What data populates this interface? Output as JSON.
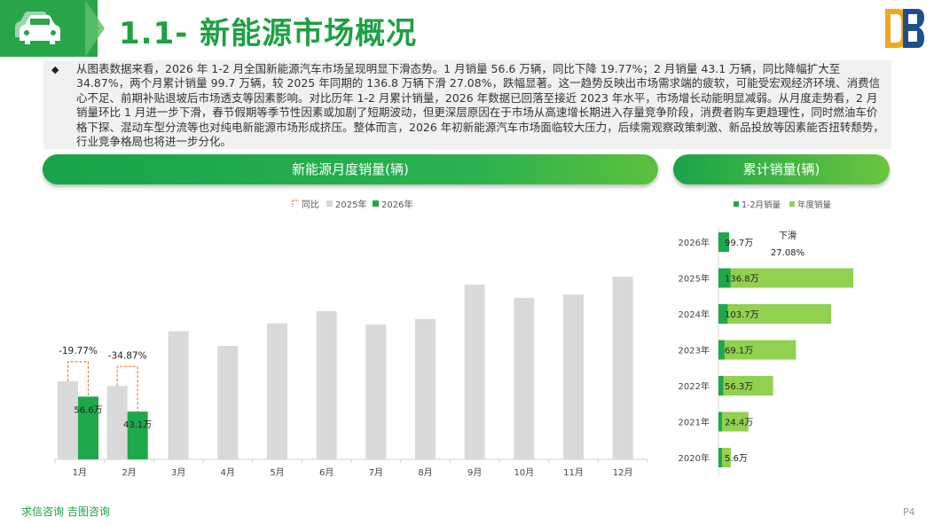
{
  "header": {
    "title": "1.1- 新能源市场概况",
    "car_icon": "car-icon",
    "logo_icon": "brand-logo-icon",
    "colors": {
      "primary": "#27a548",
      "accent": "#1ea043"
    }
  },
  "summary": {
    "bullet": "◆",
    "text": "从图表数据来看，2026 年 1-2 月全国新能源汽车市场呈现明显下滑态势。1 月销量 56.6 万辆，同比下降 19.77%；2 月销量 43.1 万辆，同比降幅扩大至 34.87%，两个月累计销量 99.7 万辆，较 2025 年同期的 136.8 万辆下滑 27.08%，跌幅显著。这一趋势反映出市场需求端的疲软，可能受宏观经济环境、消费信心不足、前期补贴退坡后市场透支等因素影响。对比历年 1-2 月累计销量，2026 年数据已回落至接近 2023 年水平，市场增长动能明显减弱。从月度走势看，2 月销量环比 1 月进一步下滑，春节假期等季节性因素或加剧了短期波动，但更深层原因在于市场从高速增长期进入存量竞争阶段，消费者购车更趋理性，同时燃油车价格下探、混动车型分流等也对纯电新能源市场形成挤压。整体而言，2026 年初新能源汽车市场面临较大压力，后续需观察政策刺激、新品投放等因素能否扭转颓势，行业竞争格局也将进一步分化。"
  },
  "sections": {
    "monthly_title": "新能源月度销量(辆)",
    "cumulative_title": "累计销量(辆)"
  },
  "footer": {
    "brand": "求信咨询 吉图咨询",
    "page": "P4"
  },
  "chart_data": [
    {
      "type": "bar",
      "title": "新能源月度销量(辆)",
      "legend": [
        "同比",
        "2025年",
        "2026年"
      ],
      "legend_position": "top-center",
      "categories": [
        "1月",
        "2月",
        "3月",
        "4月",
        "5月",
        "6月",
        "7月",
        "8月",
        "9月",
        "10月",
        "11月",
        "12月"
      ],
      "series": [
        {
          "name": "2025年",
          "color": "#d9d9d9",
          "values": [
            70.5,
            66.2,
            115.6,
            102.4,
            122.7,
            133.7,
            121.6,
            126.6,
            157.6,
            145.7,
            148.7,
            164.8
          ]
        },
        {
          "name": "2026年",
          "color": "#1fa84a",
          "values": [
            56.6,
            43.1,
            null,
            null,
            null,
            null,
            null,
            null,
            null,
            null,
            null,
            null
          ]
        }
      ],
      "data_labels": {
        "2026年": [
          "56.6万",
          "43.1万"
        ]
      },
      "yoy": {
        "name": "同比",
        "values": [
          "-19.77%",
          "-34.87%"
        ],
        "color": "#ed7d31"
      },
      "ylim": [
        0,
        200
      ],
      "grid": false
    },
    {
      "type": "bar",
      "orientation": "horizontal",
      "title": "累计销量(辆)",
      "legend": [
        "1-2月销量",
        "年度销量"
      ],
      "legend_position": "top-center",
      "categories": [
        "2026年",
        "2025年",
        "2024年",
        "2023年",
        "2022年",
        "2021年",
        "2020年"
      ],
      "series": [
        {
          "name": "1-2月销量",
          "color": "#1fa84a",
          "values": [
            99.7,
            136.8,
            103.7,
            69.1,
            56.3,
            24.4,
            5.6
          ]
        },
        {
          "name": "年度销量",
          "color": "#92d050",
          "values": [
            99.7,
            1530,
            1280,
            880,
            620,
            340,
            140
          ]
        }
      ],
      "data_labels": [
        "99.7万",
        "136.8万",
        "103.7万",
        "69.1万",
        "56.3万",
        "24.4万",
        "5.6万"
      ],
      "annotation": {
        "line1": "下滑",
        "line2": "27.08%"
      },
      "grid": false
    }
  ]
}
